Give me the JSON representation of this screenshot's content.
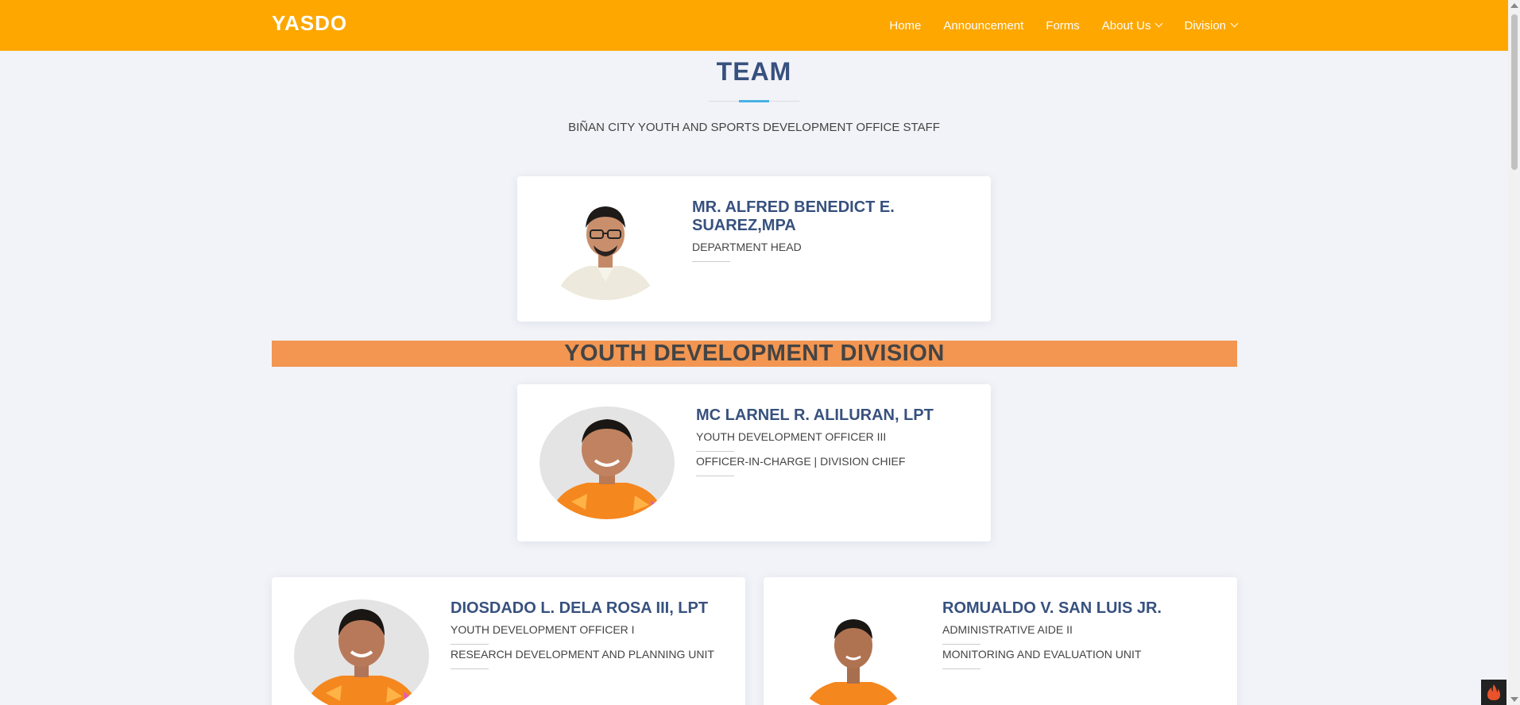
{
  "header": {
    "logo": "YASDO",
    "nav": [
      {
        "label": "Home",
        "dropdown": false
      },
      {
        "label": "Announcement",
        "dropdown": false
      },
      {
        "label": "Forms",
        "dropdown": false
      },
      {
        "label": "About Us",
        "dropdown": true
      },
      {
        "label": "Division",
        "dropdown": true
      }
    ]
  },
  "section": {
    "title": "TEAM",
    "subtitle": "BIÑAN CITY YOUTH AND SPORTS DEVELOPMENT OFFICE STAFF"
  },
  "head": {
    "name_line1": "MR. ALFRED BENEDICT E.",
    "name_line2": "SUAREZ,MPA",
    "role": "DEPARTMENT HEAD"
  },
  "division": {
    "title": "YOUTH DEVELOPMENT DIVISION"
  },
  "chief": {
    "name": "MC LARNEL R. ALILURAN, LPT",
    "role1": "YOUTH DEVELOPMENT OFFICER III",
    "role2": "OFFICER-IN-CHARGE | DIVISION CHIEF"
  },
  "members": [
    {
      "name": "DIOSDADO L. DELA ROSA III, LPT",
      "role1": "YOUTH DEVELOPMENT OFFICER I",
      "role2": "RESEARCH DEVELOPMENT AND PLANNING UNIT"
    },
    {
      "name": "ROMUALDO V. SAN LUIS JR.",
      "role1": "ADMINISTRATIVE AIDE II",
      "role2": "MONITORING AND EVALUATION UNIT"
    }
  ],
  "colors": {
    "navbar": "#fea700",
    "title": "#37517e",
    "accent": "#47b2e4",
    "division_band": "#f29651",
    "jersey_orange": "#f5871f"
  }
}
